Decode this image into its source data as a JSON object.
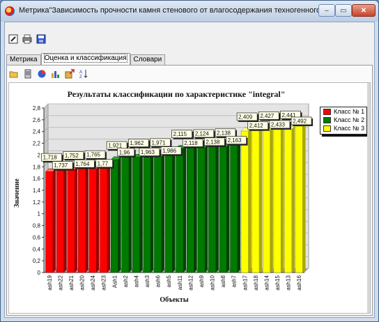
{
  "window": {
    "title": "Метрика\"Зависимость прочности камня стенового от влагосодержания техногенного отхода\"",
    "minimize": "–",
    "maximize": "▭",
    "close": "✕"
  },
  "toolbar": {
    "icons": [
      "edit-icon",
      "print-icon",
      "save-icon"
    ]
  },
  "tabs": [
    {
      "label": "Метрика",
      "active": false
    },
    {
      "label": "Оценка и классификация",
      "active": true
    },
    {
      "label": "Словари",
      "active": false
    }
  ],
  "subtoolbar": {
    "icons": [
      "open-folder-icon",
      "document-icon",
      "pie-chart-icon",
      "bar-chart-icon",
      "export-icon",
      "sort-az-icon"
    ]
  },
  "chart_data": {
    "type": "bar",
    "title": "Результаты классификации по характеристике \"integral\"",
    "xlabel": "Объекты",
    "ylabel": "Значение",
    "ylim": [
      0,
      2.8
    ],
    "yticks": [
      "0",
      "0,2",
      "0,4",
      "0,6",
      "0,8",
      "1",
      "1,2",
      "1,4",
      "1,6",
      "1,8",
      "2",
      "2,2",
      "2,4",
      "2,6",
      "2,8"
    ],
    "grid": true,
    "legend_position": "top-right",
    "categories": [
      "ash19",
      "ash22",
      "ash21",
      "ash20",
      "ash24",
      "ash23",
      "Ash1",
      "ash2",
      "ash4",
      "ash3",
      "ash6",
      "ash5",
      "ash11",
      "ash12",
      "ash9",
      "ash10",
      "ash8",
      "ash7",
      "ash17",
      "ash18",
      "ash14",
      "ash15",
      "ash13",
      "ash16"
    ],
    "values": [
      1.718,
      1.737,
      1.752,
      1.764,
      1.765,
      1.77,
      1.921,
      1.96,
      1.962,
      1.963,
      1.971,
      1.986,
      2.115,
      2.118,
      2.124,
      2.138,
      2.138,
      2.163,
      2.409,
      2.412,
      2.427,
      2.433,
      2.441,
      2.492
    ],
    "labels": [
      "1,718",
      "1,737",
      "1,752",
      "1,764",
      "1,765",
      "1,77",
      "1,921",
      "1,96",
      "1,962",
      "1,963",
      "1,971",
      "1,986",
      "2,115",
      "2,118",
      "2,124",
      "2,138",
      "2,138",
      "2,163",
      "2,409",
      "2,412",
      "2,427",
      "2,433",
      "2,441",
      "2,492"
    ],
    "class_of_bar": [
      0,
      0,
      0,
      0,
      0,
      0,
      1,
      1,
      1,
      1,
      1,
      1,
      1,
      1,
      1,
      1,
      1,
      1,
      2,
      2,
      2,
      2,
      2,
      2
    ],
    "series": [
      {
        "name": "Класс № 1",
        "color": "#ff0000"
      },
      {
        "name": "Класс № 2",
        "color": "#007a00"
      },
      {
        "name": "Класс № 3",
        "color": "#ffff00"
      }
    ]
  }
}
